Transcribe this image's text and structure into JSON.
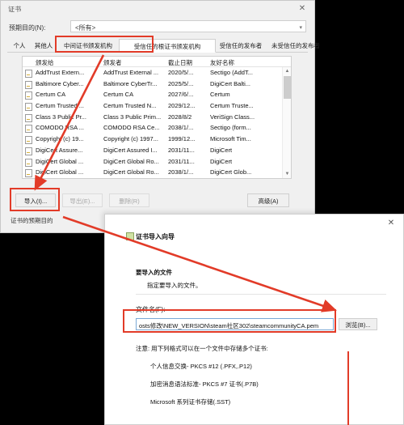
{
  "cert_window": {
    "title": "证书",
    "close_icon": "close-icon",
    "purpose": {
      "label": "预期目的(N):",
      "value": "<所有>",
      "chevron_icon": "chevron-down-icon"
    },
    "tabs": [
      {
        "label": "个人",
        "selected": false
      },
      {
        "label": "其他人",
        "selected": false
      },
      {
        "label": "中间证书颁发机构",
        "selected": false
      },
      {
        "label": "受信任的根证书颁发机构",
        "selected": true
      },
      {
        "label": "受信任的发布者",
        "selected": false
      },
      {
        "label": "未受信任的发布者",
        "selected": false
      }
    ],
    "list": {
      "columns": [
        "颁发给",
        "颁发者",
        "截止日期",
        "友好名称"
      ],
      "rows": [
        [
          "AddTrust Extern...",
          "AddTrust External ...",
          "2020/5/...",
          "Sectigo (AddT..."
        ],
        [
          "Baltimore Cyber...",
          "Baltimore CyberTr...",
          "2025/5/...",
          "DigiCert Balti..."
        ],
        [
          "Certum CA",
          "Certum CA",
          "2027/6/...",
          "Certum"
        ],
        [
          "Certum Trusted ...",
          "Certum Trusted N...",
          "2029/12...",
          "Certum Truste..."
        ],
        [
          "Class 3 Public Pr...",
          "Class 3 Public Prim...",
          "2028/8/2",
          "VeriSign Class..."
        ],
        [
          "COMODO RSA ...",
          "COMODO RSA Ce...",
          "2038/1/...",
          "Sectigo (form..."
        ],
        [
          "Copyright (c) 19...",
          "Copyright (c) 1997...",
          "1999/12...",
          "Microsoft Tim..."
        ],
        [
          "DigiCert Assure...",
          "DigiCert Assured I...",
          "2031/11...",
          "DigiCert"
        ],
        [
          "DigiCert Global ...",
          "DigiCert Global Ro...",
          "2031/11...",
          "DigiCert"
        ],
        [
          "DigiCert Global ...",
          "DigiCert Global Ro...",
          "2038/1/...",
          "DigiCert Glob..."
        ]
      ],
      "scroll_up_icon": "caret-up-icon",
      "scroll_down_icon": "caret-down-icon",
      "row_icon": "certificate-icon"
    },
    "buttons": {
      "import": "导入(I)...",
      "export": "导出(E)...",
      "remove": "删除(R)",
      "advanced": "高级(A)"
    },
    "footnote": "证书的预期目的"
  },
  "wizard": {
    "title": "证书导入向导",
    "title_icon": "certificate-wizard-icon",
    "close_icon": "close-icon",
    "section_heading": "要导入的文件",
    "section_text": "指定要导入的文件。",
    "file": {
      "label": "文件名(F):",
      "value": "osts修改\\NEW_VERSION\\steam社区302\\steamcommunityCA.pem",
      "browse_button": "浏览(B)..."
    },
    "notes": {
      "title": "注意: 用下列格式可以在一个文件中存储多个证书:",
      "items": [
        "个人信息交换- PKCS #12 (.PFX,.P12)",
        "加密消息语法标准- PKCS #7 证书(.P7B)",
        "Microsoft 系列证书存储(.SST)"
      ]
    }
  },
  "annotations": {
    "accent_color": "#e23b28",
    "highlight_tab": "受信任的根证书颁发机构",
    "highlight_import": "导入(I)...",
    "highlight_file_field": "文件名(F)"
  }
}
